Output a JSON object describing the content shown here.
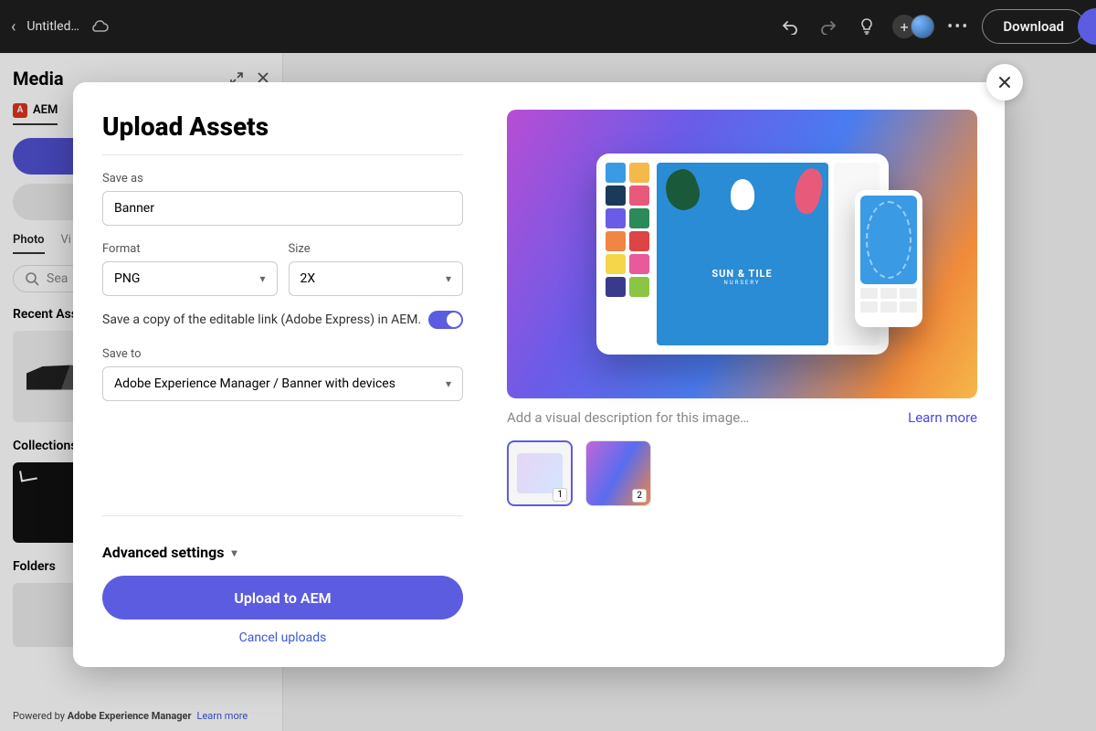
{
  "topbar": {
    "title": "Untitled…",
    "download": "Download"
  },
  "sidebar": {
    "title": "Media",
    "aem_tab": "AEM",
    "photo_tab": "Photo",
    "video_tab": "Vi",
    "search_placeholder": "Sea",
    "recent_label": "Recent Ass",
    "collections_label": "Collections",
    "folders_label": "Folders",
    "powered_prefix": "Powered by ",
    "powered_brand": "Adobe Experience Manager",
    "powered_link": "Learn more"
  },
  "modal": {
    "title": "Upload Assets",
    "save_as_label": "Save as",
    "save_as_value": "Banner",
    "format_label": "Format",
    "format_value": "PNG",
    "size_label": "Size",
    "size_value": "2X",
    "toggle_label": "Save a copy of the editable link (Adobe Express) in AEM.",
    "save_to_label": "Save to",
    "save_to_value": "Adobe Experience Manager / Banner with devices",
    "advanced": "Advanced settings",
    "upload_btn": "Upload to AEM",
    "cancel": "Cancel uploads",
    "poster_title": "SUN & TILE",
    "poster_sub": "NURSERY",
    "desc_placeholder": "Add a visual description for this image…",
    "learn_more": "Learn more",
    "thumb1_badge": "1",
    "thumb2_badge": "2"
  }
}
